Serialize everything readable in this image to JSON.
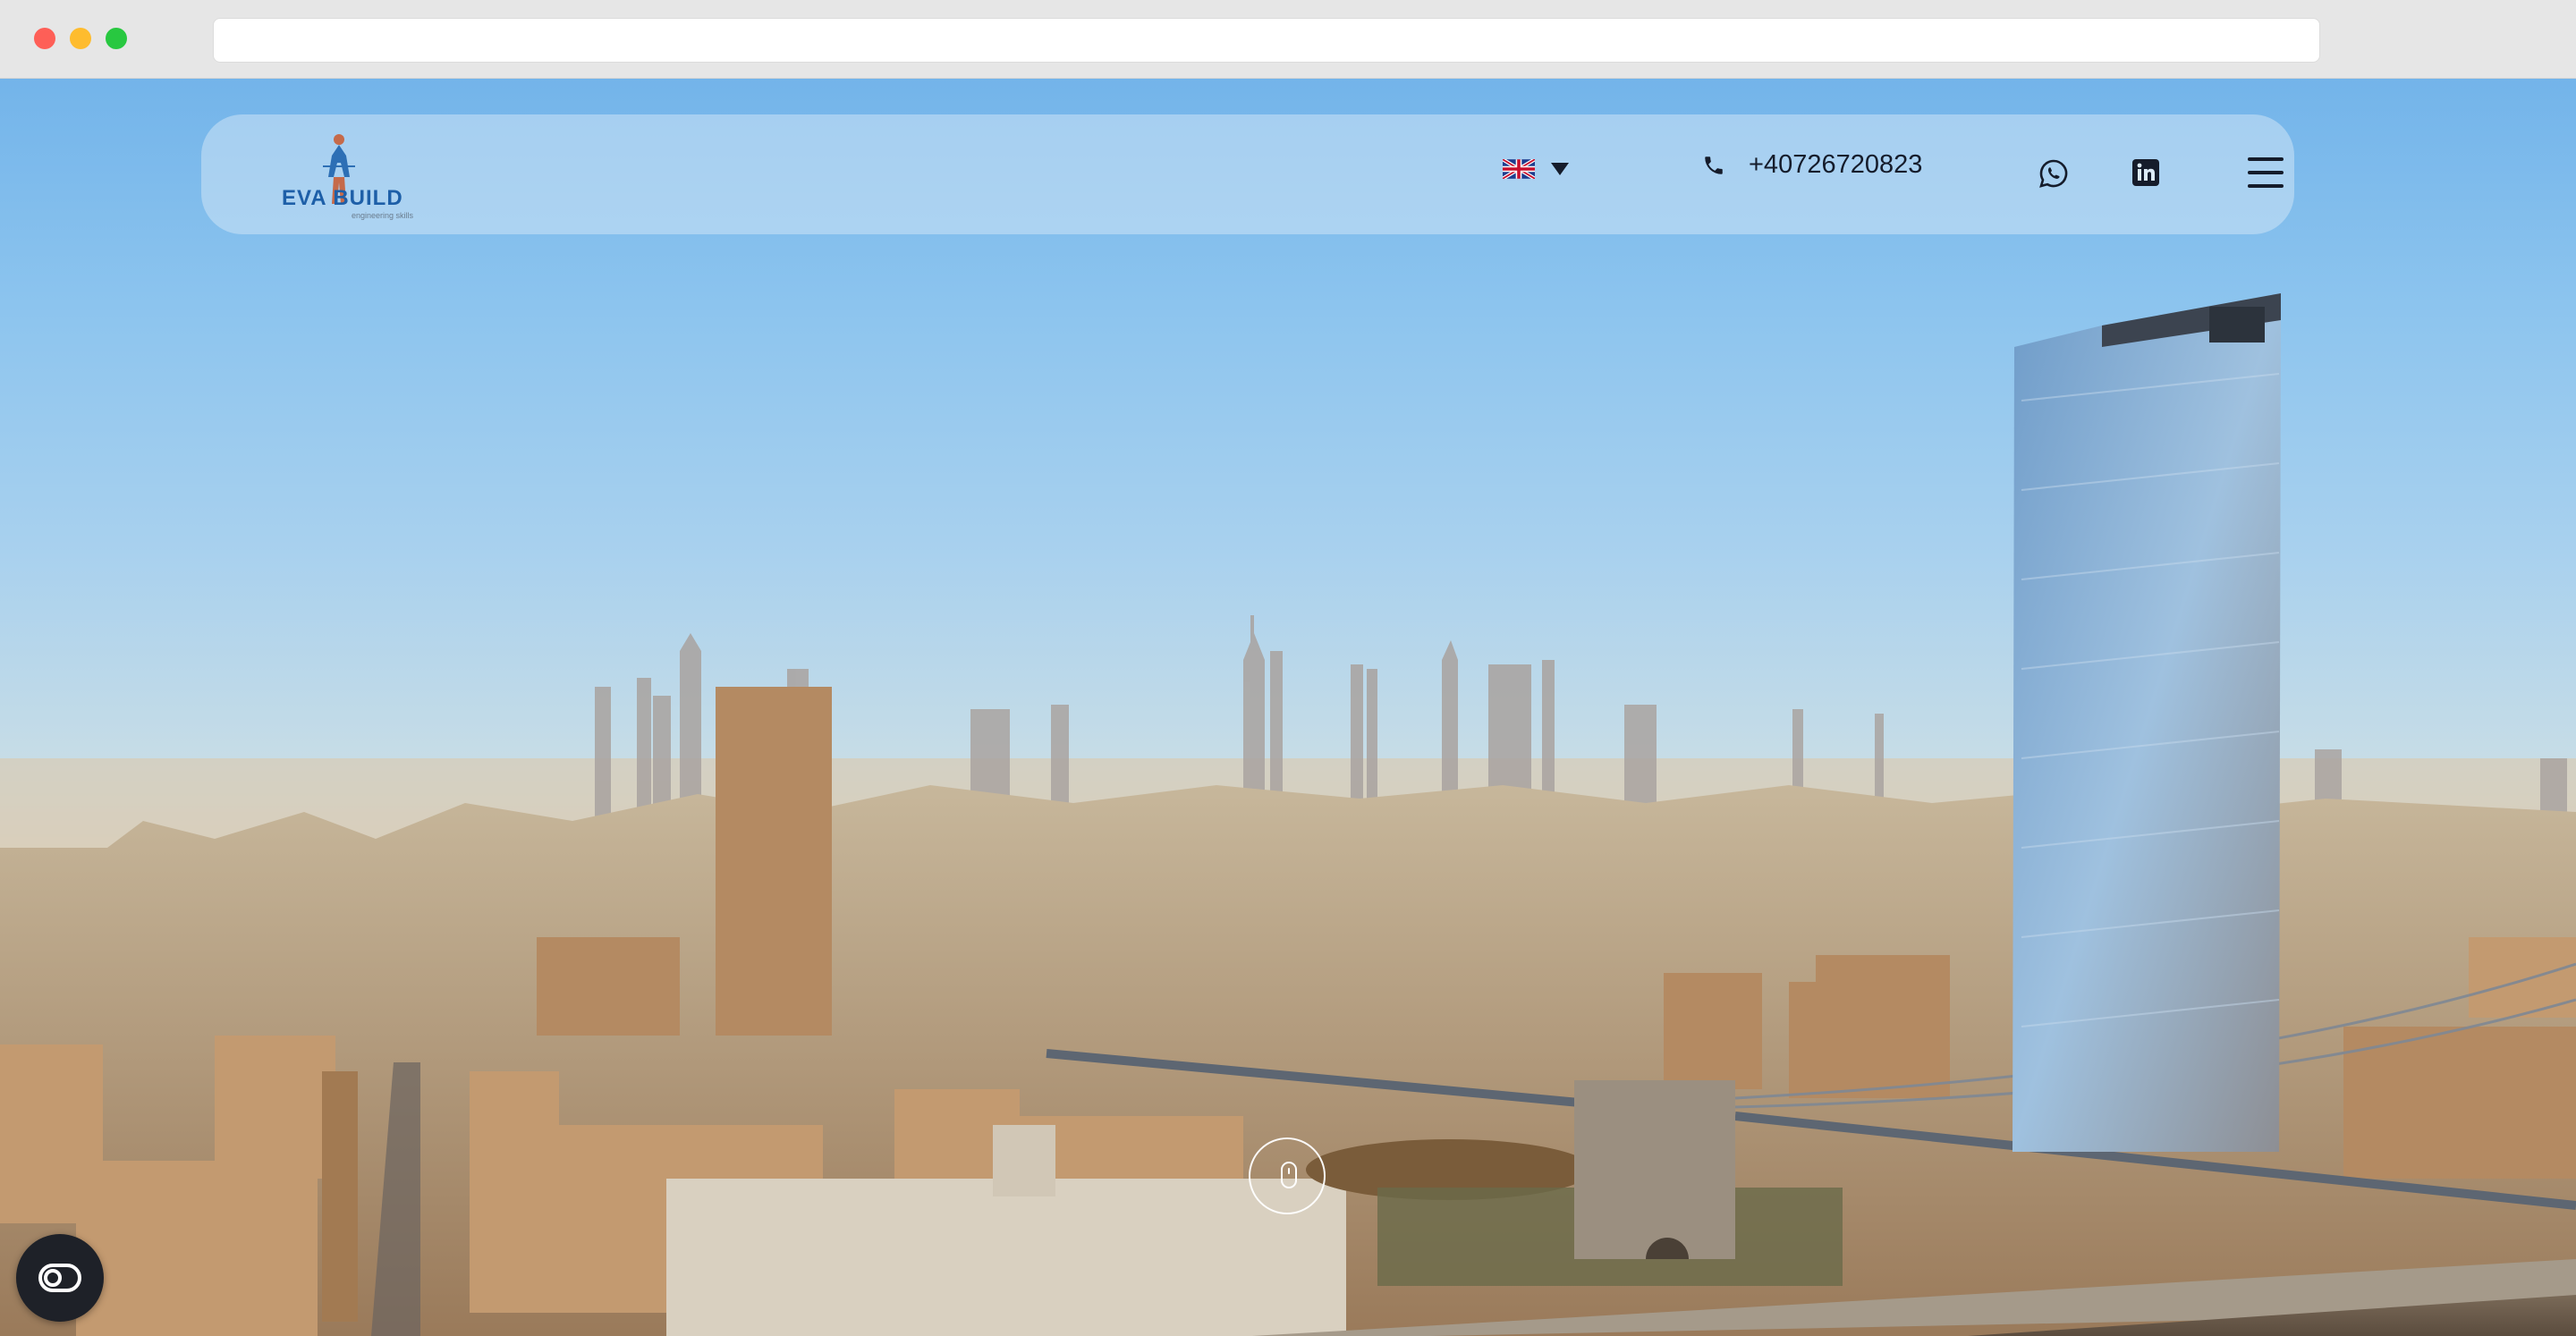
{
  "browser": {
    "url": ""
  },
  "header": {
    "logo": {
      "brand": "EVA BUILD",
      "tagline": "engineering skills"
    },
    "language": {
      "selected": "English",
      "icon": "uk-flag-icon"
    },
    "phone": {
      "number": "+40726720823",
      "icon": "phone-icon"
    },
    "social": [
      {
        "name": "WhatsApp",
        "icon": "whatsapp-icon"
      },
      {
        "name": "LinkedIn",
        "icon": "linkedin-icon"
      }
    ],
    "menu_icon": "hamburger-menu-icon"
  },
  "hero": {
    "background": "aerial-city-skyline-photo",
    "scroll_icon": "mouse-scroll-icon"
  },
  "consent_badge": {
    "icon": "cookie-consent-icon"
  },
  "colors": {
    "brand_blue": "#1d5fa8",
    "text_dark": "#151c2b",
    "badge_bg": "#1e2128"
  }
}
